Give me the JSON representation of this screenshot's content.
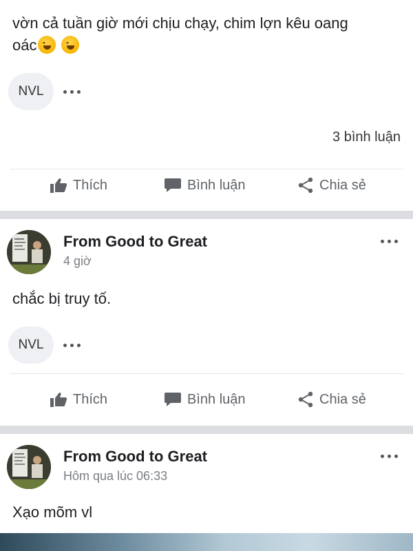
{
  "posts": [
    {
      "text_line1": "vờn cả tuần giờ mới chịu chạy, chim lợn kêu oang",
      "text_line2": "oác",
      "reaction_label": "NVL",
      "comments_count": "3 bình luận",
      "actions": {
        "like": "Thích",
        "comment": "Bình luận",
        "share": "Chia sẻ"
      }
    },
    {
      "author": "From Good to Great",
      "time": "4 giờ",
      "text": "chắc bị truy tố.",
      "reaction_label": "NVL",
      "actions": {
        "like": "Thích",
        "comment": "Bình luận",
        "share": "Chia sẻ"
      }
    },
    {
      "author": "From Good to Great",
      "time": "Hôm qua lúc 06:33",
      "text": "Xạo mõm vl"
    }
  ],
  "icons": [
    "like-icon",
    "comment-icon",
    "share-icon",
    "more-options-icon",
    "laughing-emoji-icon"
  ],
  "colors": {
    "separator": "#dcdde1",
    "action_text": "#5f6368",
    "meta_text": "#7a7d82"
  }
}
